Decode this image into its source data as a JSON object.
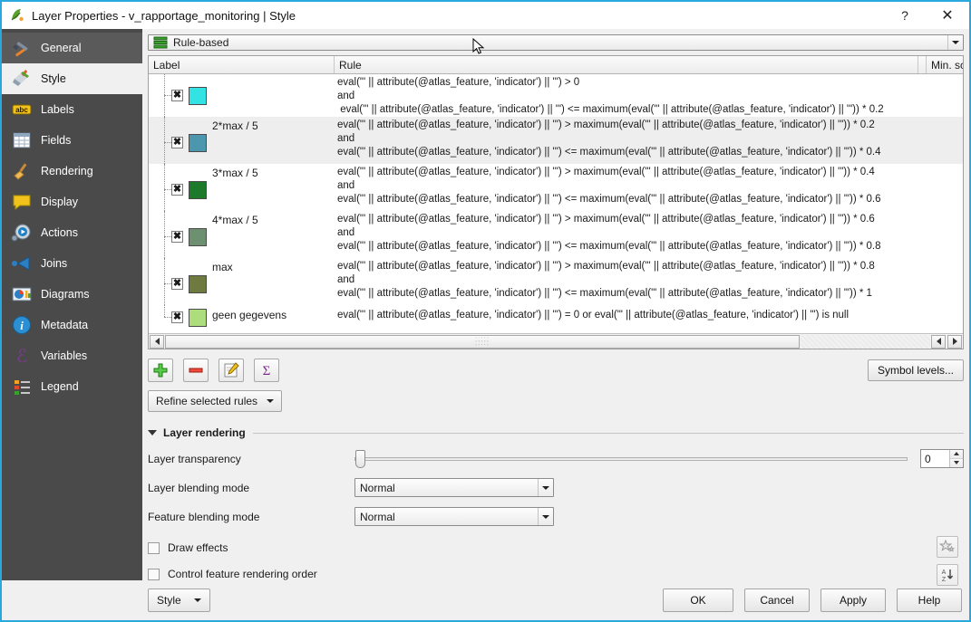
{
  "window": {
    "title": "Layer Properties - v_rapportage_monitoring | Style",
    "icon": "qgis-logo-icon",
    "help_button": "?",
    "close_button": "✕"
  },
  "sidebar": {
    "items": [
      {
        "label": "General",
        "icon": "tools-icon"
      },
      {
        "label": "Style",
        "icon": "paintbrush-icon"
      },
      {
        "label": "Labels",
        "icon": "abc-label-icon"
      },
      {
        "label": "Fields",
        "icon": "table-grid-icon"
      },
      {
        "label": "Rendering",
        "icon": "broom-icon"
      },
      {
        "label": "Display",
        "icon": "speech-bubble-icon"
      },
      {
        "label": "Actions",
        "icon": "gear-play-icon"
      },
      {
        "label": "Joins",
        "icon": "join-arrow-icon"
      },
      {
        "label": "Diagrams",
        "icon": "chart-icon"
      },
      {
        "label": "Metadata",
        "icon": "info-circle-icon"
      },
      {
        "label": "Variables",
        "icon": "epsilon-icon"
      },
      {
        "label": "Legend",
        "icon": "legend-list-icon"
      }
    ],
    "selected": "Style"
  },
  "renderer": {
    "value": "Rule-based",
    "icon": "rule-based-icon"
  },
  "rules_table": {
    "columns": [
      "Label",
      "Rule",
      "Min. sc"
    ],
    "rows": [
      {
        "label": "",
        "checked": true,
        "color": "#33e2e2",
        "rule_lines": [
          "eval(\"' || attribute(@atlas_feature, 'indicator') || '\") > 0",
          "and",
          " eval(\"' || attribute(@atlas_feature, 'indicator') || '\") <= maximum(eval(\"' || attribute(@atlas_feature, 'indicator') || '\")) * 0.2"
        ]
      },
      {
        "label": "2*max / 5",
        "checked": true,
        "color": "#4d97ae",
        "rule_lines": [
          "eval(\"' || attribute(@atlas_feature, 'indicator') || '\") > maximum(eval(\"' || attribute(@atlas_feature, 'indicator') || '\")) * 0.2",
          "and",
          "eval(\"' || attribute(@atlas_feature, 'indicator') || '\") <= maximum(eval(\"' || attribute(@atlas_feature, 'indicator') || '\")) * 0.4"
        ]
      },
      {
        "label": "3*max / 5",
        "checked": true,
        "color": "#1c7a2a",
        "rule_lines": [
          "eval(\"' || attribute(@atlas_feature, 'indicator') || '\") > maximum(eval(\"' || attribute(@atlas_feature, 'indicator') || '\")) * 0.4",
          "and",
          "eval(\"' || attribute(@atlas_feature, 'indicator') || '\") <= maximum(eval(\"' || attribute(@atlas_feature, 'indicator') || '\")) * 0.6"
        ]
      },
      {
        "label": "4*max / 5",
        "checked": true,
        "color": "#6d9070",
        "rule_lines": [
          "eval(\"' || attribute(@atlas_feature, 'indicator') || '\") > maximum(eval(\"' || attribute(@atlas_feature, 'indicator') || '\")) * 0.6",
          "and",
          "eval(\"' || attribute(@atlas_feature, 'indicator') || '\") <= maximum(eval(\"' || attribute(@atlas_feature, 'indicator') || '\")) * 0.8"
        ]
      },
      {
        "label": "max",
        "checked": true,
        "color": "#6d7a40",
        "rule_lines": [
          "eval(\"' || attribute(@atlas_feature, 'indicator') || '\") > maximum(eval(\"' || attribute(@atlas_feature, 'indicator') || '\")) * 0.8",
          "and",
          "eval(\"' || attribute(@atlas_feature, 'indicator') || '\") <= maximum(eval(\"' || attribute(@atlas_feature, 'indicator') || '\")) * 1"
        ]
      },
      {
        "label": "geen gegevens",
        "checked": true,
        "color": "#aedd7d",
        "rule_lines": [
          "eval(\"' || attribute(@atlas_feature, 'indicator') || '\") = 0 or eval(\"' || attribute(@atlas_feature, 'indicator') || '\") is null"
        ]
      }
    ]
  },
  "toolbar": {
    "add_rule": "add-rule-icon",
    "remove_rule": "remove-rule-icon",
    "edit_rule": "edit-rule-icon",
    "count_features": "count-features-sigma-icon",
    "symbol_levels": "Symbol levels...",
    "refine": "Refine selected rules"
  },
  "layer_rendering": {
    "title": "Layer rendering",
    "transparency_label": "Layer transparency",
    "transparency_value": "0",
    "layer_blending_label": "Layer blending mode",
    "layer_blending_value": "Normal",
    "feature_blending_label": "Feature blending mode",
    "feature_blending_value": "Normal",
    "draw_effects_label": "Draw effects",
    "draw_effects_checked": false,
    "control_order_label": "Control feature rendering order",
    "control_order_checked": false,
    "effects_button": "effects-star-icon",
    "order_button": "sort-az-icon"
  },
  "footer": {
    "style_button": "Style",
    "ok": "OK",
    "cancel": "Cancel",
    "apply": "Apply",
    "help": "Help"
  }
}
